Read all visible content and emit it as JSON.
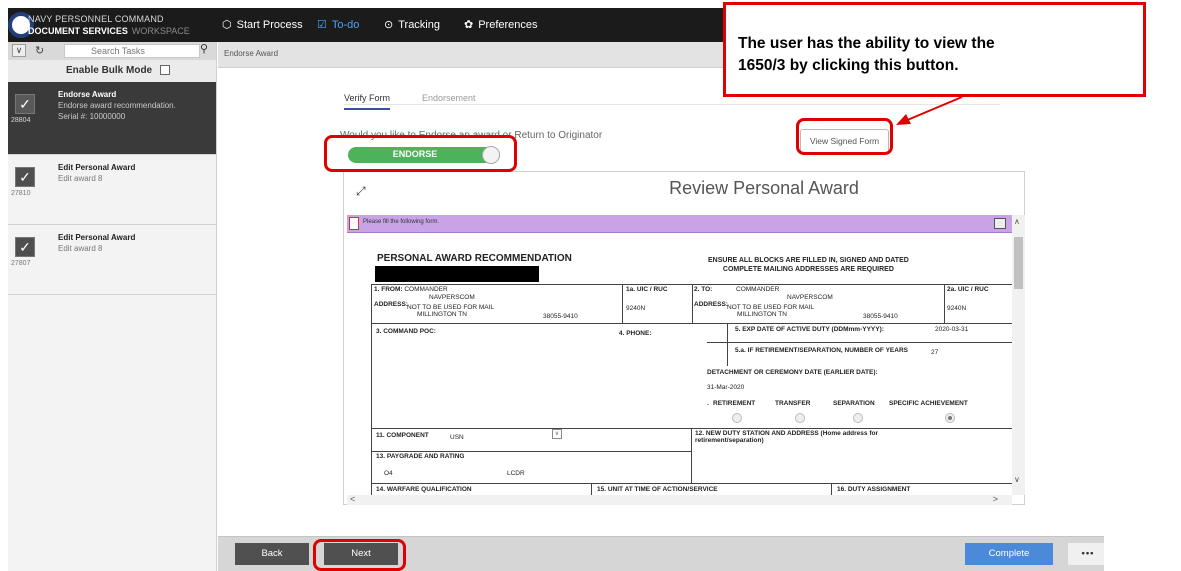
{
  "app": {
    "brand_line1": "NAVY PERSONNEL COMMAND",
    "brand_line2": "DOCUMENT SERVICES",
    "brand_workspace": "WORKSPACE"
  },
  "nav": {
    "items": [
      {
        "label": "Start Process",
        "icon": "start-icon",
        "active": false
      },
      {
        "label": "To-do",
        "icon": "checklist-icon",
        "active": true
      },
      {
        "label": "Tracking",
        "icon": "tracking-icon",
        "active": false
      },
      {
        "label": "Preferences",
        "icon": "gear-icon",
        "active": false
      }
    ]
  },
  "sidebar": {
    "search_placeholder": "Search Tasks",
    "bulk_mode_label": "Enable Bulk Mode",
    "tasks": [
      {
        "title": "Endorse Award",
        "desc": "Endorse award recommendation.",
        "number": "28804",
        "serial": "Serial #: 10000000",
        "selected": true
      },
      {
        "title": "Edit Personal Award",
        "desc": "Edit award 8",
        "number": "27810",
        "serial": "",
        "selected": false
      },
      {
        "title": "Edit Personal Award",
        "desc": "Edit award 8",
        "number": "27807",
        "serial": "",
        "selected": false
      }
    ]
  },
  "breadcrumb": "Endorse Award",
  "tabs": [
    {
      "label": "Verify Form",
      "active": true
    },
    {
      "label": "Endorsement",
      "active": false
    }
  ],
  "question": "Would you like to Endorse an award or Return to Originator",
  "toggle_label": "ENDORSE",
  "view_signed_form_label": "View Signed Form",
  "viewer": {
    "title": "Review Personal Award",
    "pdf_message": "Please fill the following form."
  },
  "form": {
    "title": "PERSONAL AWARD RECOMMENDATION",
    "ensure_line1": "ENSURE ALL BLOCKS ARE FILLED IN, SIGNED AND DATED",
    "ensure_line2": "COMPLETE MAILING ADDRESSES ARE REQUIRED",
    "from_label": "1. FROM:",
    "from_value": "COMMANDER",
    "from_org": "NAVPERSCOM",
    "address_label": "ADDRESS:",
    "from_addr1": "NOT TO BE USED FOR MAIL",
    "from_addr2": "MILLINGTON TN",
    "from_zip": "38055-9410",
    "uic1_label": "1a. UIC / RUC",
    "uic1_value": "9240N",
    "to_label": "2. TO:",
    "to_value": "COMMANDER",
    "to_org": "NAVPERSCOM",
    "to_addr1": "NOT TO BE USED FOR MAIL",
    "to_addr2": "MILLINGTON TN",
    "to_zip": "38055-9410",
    "uic2_label": "2a. UIC / RUC",
    "uic2_value": "9240N",
    "poc_label": "3. COMMAND POC:",
    "phone_label": "4. PHONE:",
    "exp_label": "5. EXP DATE OF ACTIVE DUTY (DDMmm-YYYY):",
    "exp_value": "2020-03-31",
    "years_label": "5.a. IF RETIREMENT/SEPARATION, NUMBER OF YEARS",
    "years_value": "27",
    "detach_label": "DETACHMENT OR CEREMONY DATE (EARLIER DATE):",
    "detach_value": "31-Mar-2020",
    "occasion_prefix": ".",
    "occasions": [
      "RETIREMENT",
      "TRANSFER",
      "SEPARATION",
      "SPECIFIC ACHIEVEMENT"
    ],
    "component_label": "11. COMPONENT",
    "component_value": "USN",
    "new_duty_label": "12. NEW DUTY STATION AND ADDRESS (Home address for",
    "new_duty_label2": "retirement/separation)",
    "paygrade_label": "13. PAYGRADE AND RATING",
    "paygrade_value": "O4",
    "rating_value": "LCDR",
    "warfare_label": "14. WARFARE QUALIFICATION",
    "unit_label": "15. UNIT AT TIME OF ACTION/SERVICE",
    "duty_label": "16. DUTY ASSIGNMENT"
  },
  "footer": {
    "back_label": "Back",
    "next_label": "Next",
    "complete_label": "Complete",
    "more_label": "•••"
  },
  "callout": {
    "line1": "The user has the ability to view the",
    "line2": "1650/3 by clicking this button."
  },
  "colors": {
    "highlight": "#e00000",
    "toggle_on": "#4cb35a",
    "complete": "#4a8ad8",
    "active_nav": "#4aa3ff"
  }
}
